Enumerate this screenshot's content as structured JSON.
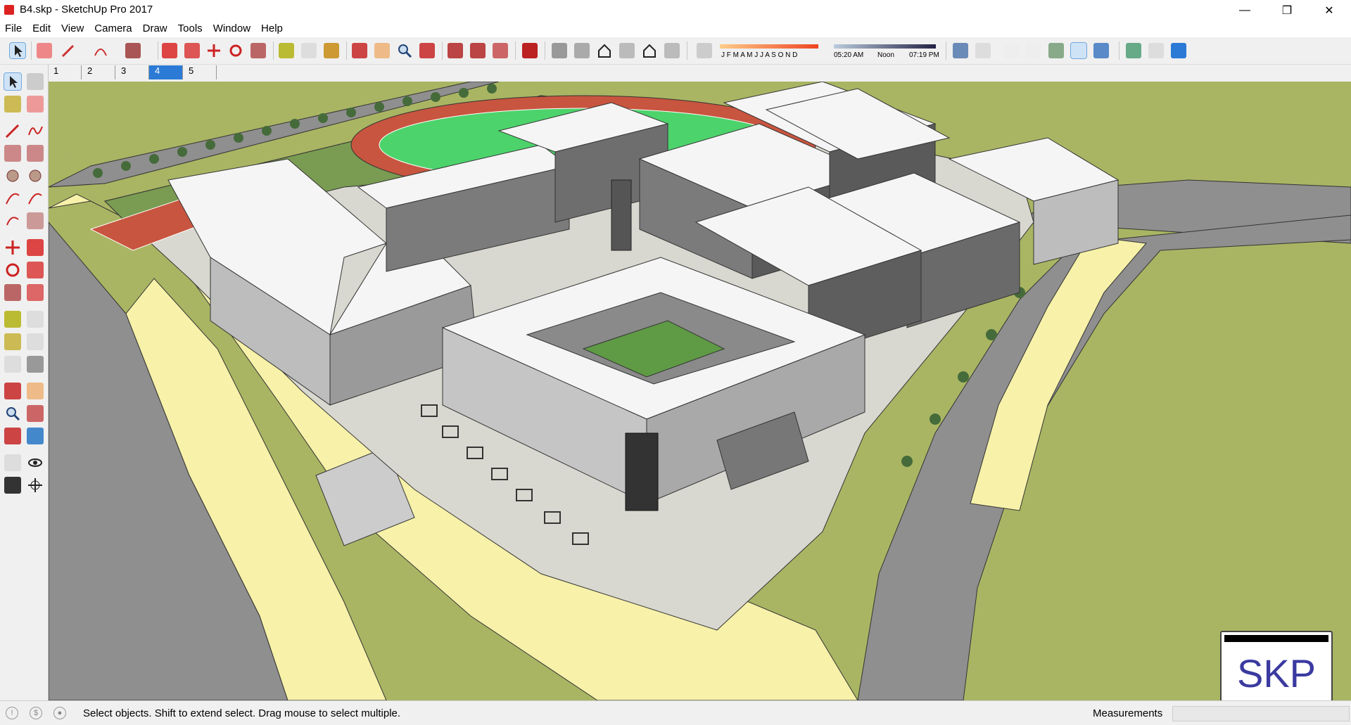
{
  "window": {
    "title": "B4.skp - SketchUp Pro 2017",
    "min": "—",
    "max": "❐",
    "close": "✕"
  },
  "menu": [
    "File",
    "Edit",
    "View",
    "Camera",
    "Draw",
    "Tools",
    "Window",
    "Help"
  ],
  "shadow_toolbar": {
    "months": "J F M A M J J A S O N D",
    "time_start": "05:20 AM",
    "time_mid": "Noon",
    "time_end": "07:19 PM"
  },
  "scenes": [
    {
      "label": "1",
      "active": false
    },
    {
      "label": "2",
      "active": false
    },
    {
      "label": "3",
      "active": false
    },
    {
      "label": "4",
      "active": true
    },
    {
      "label": "5",
      "active": false
    }
  ],
  "status": {
    "message": "Select objects. Shift to extend select. Drag mouse to select multiple.",
    "measurements_label": "Measurements",
    "measurements_value": ""
  },
  "watermark": {
    "text": "SKP"
  },
  "colors": {
    "grass": "#a9b563",
    "road": "#8f8f8f",
    "sidewalk": "#f7f1a9",
    "track": "#c8553f",
    "field": "#4cd36b",
    "building": "#f5f5f5",
    "selection": "#2a7ad6"
  }
}
